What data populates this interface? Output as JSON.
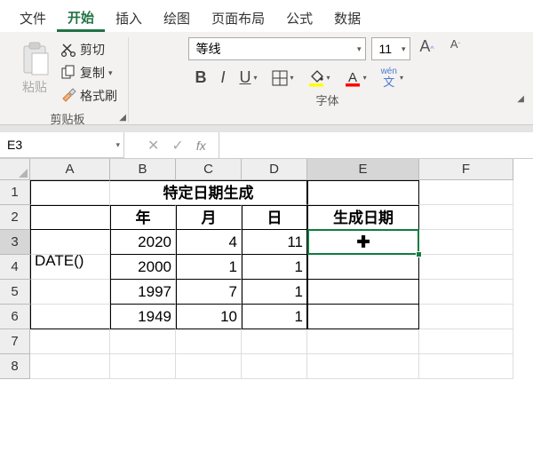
{
  "menu": {
    "file": "文件",
    "home": "开始",
    "insert": "插入",
    "draw": "绘图",
    "layout": "页面布局",
    "formulas": "公式",
    "data": "数据"
  },
  "ribbon": {
    "clipboard": {
      "paste": "粘贴",
      "cut": "剪切",
      "copy": "复制",
      "formatPainter": "格式刷",
      "groupLabel": "剪贴板"
    },
    "font": {
      "family": "等线",
      "size": "11",
      "groupLabel": "字体",
      "bold": "B",
      "italic": "I",
      "underline": "U",
      "wen": "wén",
      "wenSub": "文"
    }
  },
  "namebox": {
    "ref": "E3"
  },
  "fx": {
    "label": "fx"
  },
  "grid": {
    "cols": [
      "A",
      "B",
      "C",
      "D",
      "E",
      "F"
    ],
    "rows": [
      "1",
      "2",
      "3",
      "4",
      "5",
      "6",
      "7",
      "8"
    ],
    "title": "特定日期生成",
    "headers": {
      "year": "年",
      "month": "月",
      "day": "日",
      "gen": "生成日期"
    },
    "funcLabel": "DATE()",
    "data": [
      {
        "y": "2020",
        "m": "4",
        "d": "11"
      },
      {
        "y": "2000",
        "m": "1",
        "d": "1"
      },
      {
        "y": "1997",
        "m": "7",
        "d": "1"
      },
      {
        "y": "1949",
        "m": "10",
        "d": "1"
      }
    ]
  },
  "chart_data": {
    "type": "table",
    "title": "特定日期生成",
    "columns": [
      "年",
      "月",
      "日",
      "生成日期"
    ],
    "rows": [
      [
        2020,
        4,
        11,
        null
      ],
      [
        2000,
        1,
        1,
        null
      ],
      [
        1997,
        7,
        1,
        null
      ],
      [
        1949,
        10,
        1,
        null
      ]
    ],
    "function": "DATE()"
  }
}
